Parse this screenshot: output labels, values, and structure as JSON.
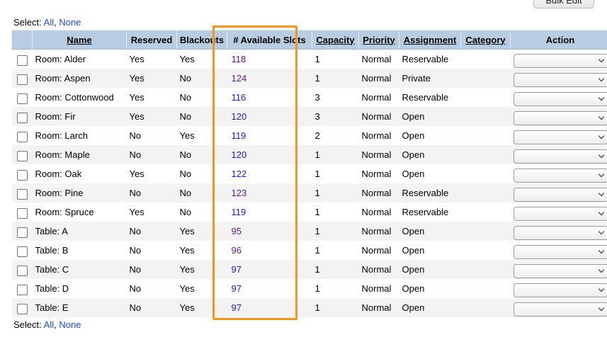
{
  "bulk_edit_label": "Bulk Edit",
  "select_prefix": "Select:",
  "select_all": "All",
  "select_none": "None",
  "comma": ",",
  "columns": {
    "name": "Name",
    "reserved": "Reserved",
    "blackouts": "Blackouts",
    "available_slots": "# Available Slots",
    "capacity": "Capacity",
    "priority": "Priority",
    "assignment": "Assignment",
    "category": "Category",
    "action": "Action"
  },
  "rows": [
    {
      "name": "Room: Alder",
      "reserved": "Yes",
      "blackouts": "Yes",
      "slots": "118",
      "slots_visited": true,
      "capacity": "1",
      "priority": "Normal",
      "assignment": "Reservable",
      "category": ""
    },
    {
      "name": "Room: Aspen",
      "reserved": "Yes",
      "blackouts": "No",
      "slots": "124",
      "slots_visited": true,
      "capacity": "1",
      "priority": "Normal",
      "assignment": "Private",
      "category": ""
    },
    {
      "name": "Room: Cottonwood",
      "reserved": "Yes",
      "blackouts": "No",
      "slots": "116",
      "slots_visited": false,
      "capacity": "3",
      "priority": "Normal",
      "assignment": "Reservable",
      "category": ""
    },
    {
      "name": "Room: Fir",
      "reserved": "Yes",
      "blackouts": "No",
      "slots": "120",
      "slots_visited": false,
      "capacity": "3",
      "priority": "Normal",
      "assignment": "Open",
      "category": ""
    },
    {
      "name": "Room: Larch",
      "reserved": "No",
      "blackouts": "Yes",
      "slots": "119",
      "slots_visited": false,
      "capacity": "2",
      "priority": "Normal",
      "assignment": "Open",
      "category": ""
    },
    {
      "name": "Room: Maple",
      "reserved": "No",
      "blackouts": "No",
      "slots": "120",
      "slots_visited": false,
      "capacity": "1",
      "priority": "Normal",
      "assignment": "Open",
      "category": ""
    },
    {
      "name": "Room: Oak",
      "reserved": "Yes",
      "blackouts": "No",
      "slots": "122",
      "slots_visited": false,
      "capacity": "1",
      "priority": "Normal",
      "assignment": "Open",
      "category": ""
    },
    {
      "name": "Room: Pine",
      "reserved": "No",
      "blackouts": "No",
      "slots": "123",
      "slots_visited": true,
      "capacity": "1",
      "priority": "Normal",
      "assignment": "Reservable",
      "category": ""
    },
    {
      "name": "Room: Spruce",
      "reserved": "Yes",
      "blackouts": "No",
      "slots": "119",
      "slots_visited": false,
      "capacity": "1",
      "priority": "Normal",
      "assignment": "Reservable",
      "category": ""
    },
    {
      "name": "Table: A",
      "reserved": "No",
      "blackouts": "Yes",
      "slots": "95",
      "slots_visited": true,
      "capacity": "1",
      "priority": "Normal",
      "assignment": "Open",
      "category": ""
    },
    {
      "name": "Table: B",
      "reserved": "No",
      "blackouts": "Yes",
      "slots": "96",
      "slots_visited": true,
      "capacity": "1",
      "priority": "Normal",
      "assignment": "Open",
      "category": ""
    },
    {
      "name": "Table: C",
      "reserved": "No",
      "blackouts": "Yes",
      "slots": "97",
      "slots_visited": false,
      "capacity": "1",
      "priority": "Normal",
      "assignment": "Open",
      "category": ""
    },
    {
      "name": "Table: D",
      "reserved": "No",
      "blackouts": "Yes",
      "slots": "97",
      "slots_visited": false,
      "capacity": "1",
      "priority": "Normal",
      "assignment": "Open",
      "category": ""
    },
    {
      "name": "Table: E",
      "reserved": "No",
      "blackouts": "Yes",
      "slots": "97",
      "slots_visited": false,
      "capacity": "1",
      "priority": "Normal",
      "assignment": "Open",
      "category": ""
    }
  ],
  "action_value": "",
  "colors": {
    "header_bg": "#b8cde2",
    "highlight": "#f7941d",
    "link": "#1a4bd1",
    "link_visited": "#5b1a8f"
  }
}
